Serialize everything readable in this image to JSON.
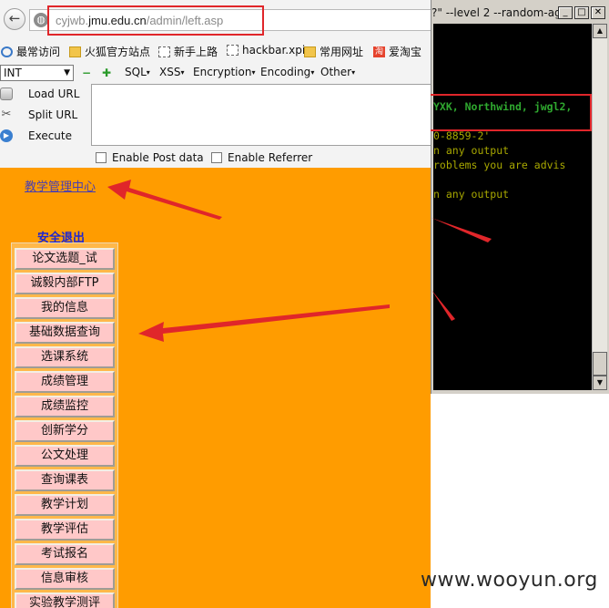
{
  "browser": {
    "url_scheme_host_prefix": "cyjwb.",
    "url_host": "jmu.edu.cn",
    "url_path": "/admin/left.asp",
    "bookmarks": [
      "最常访问",
      "火狐官方站点",
      "新手上路",
      "hackbar.xpi",
      "常用网址",
      "爱淘宝"
    ]
  },
  "hackbar": {
    "select_value": "INT",
    "menus": [
      "SQL",
      "XSS",
      "Encryption",
      "Encoding",
      "Other"
    ],
    "actions": [
      "Load URL",
      "Split URL",
      "Execute"
    ],
    "checkboxes": [
      "Enable Post data",
      "Enable Referrer"
    ]
  },
  "page": {
    "center_link": "教学管理中心",
    "logout_link": "安全退出",
    "menu_items": [
      "论文选题_试",
      "诚毅内部FTP",
      "我的信息",
      "基础数据查询",
      "选课系统",
      "成绩管理",
      "成绩监控",
      "创新学分",
      "公文处理",
      "查询课表",
      "教学计划",
      "教学评估",
      "考试报名",
      "信息审核",
      "实验教学测评"
    ]
  },
  "terminal": {
    "title": "?\" --level 2 --random-ag...",
    "lines": [
      {
        "text": "YXK, Northwind, jwgl2,",
        "style": "green"
      },
      {
        "text": "0-8859-2'",
        "style": "olive"
      },
      {
        "text": "n any output",
        "style": "olive"
      },
      {
        "text": "roblems you are advis",
        "style": "olive"
      },
      {
        "text": "n any output",
        "style": "olive"
      }
    ]
  },
  "watermark": "www.wooyun.org",
  "colors": {
    "page_bg": "#ff9c00",
    "menu_btn": "#ffc8c8",
    "highlight": "#e0262a",
    "terminal_bg": "#000000"
  }
}
